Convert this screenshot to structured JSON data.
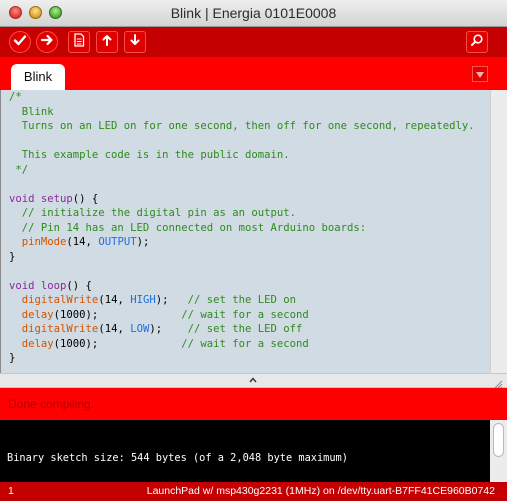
{
  "window": {
    "title": "Blink | Energia 0101E0008"
  },
  "toolbar": {
    "buttons": [
      {
        "name": "verify",
        "icon": "check-icon"
      },
      {
        "name": "upload",
        "icon": "arrow-right-icon"
      },
      {
        "name": "new",
        "icon": "document-icon"
      },
      {
        "name": "open",
        "icon": "arrow-up-icon"
      },
      {
        "name": "save",
        "icon": "arrow-down-icon"
      },
      {
        "name": "serial-monitor",
        "icon": "magnifier-icon"
      }
    ]
  },
  "tabs": [
    {
      "label": "Blink"
    }
  ],
  "editor": {
    "code": {
      "l1": "/*",
      "l2": "  Blink",
      "l3": "  Turns on an LED on for one second, then off for one second, repeatedly.",
      "l5": "  This example code is in the public domain.",
      "l6": " */",
      "l8a": "void",
      "l8b": " ",
      "l8c": "setup",
      "l8d": "() {",
      "l9": "  // initialize the digital pin as an output.",
      "l10": "  // Pin 14 has an LED connected on most Arduino boards:",
      "l11a": "  ",
      "l11b": "pinMode",
      "l11c": "(14, ",
      "l11d": "OUTPUT",
      "l11e": ");",
      "l12": "}",
      "l14a": "void",
      "l14c": "loop",
      "l14d": "() {",
      "l15b": "digitalWrite",
      "l15c": "(14, ",
      "l15d": "HIGH",
      "l15e": ");   ",
      "l15f": "// set the LED on",
      "l16b": "delay",
      "l16c": "(1000);             ",
      "l16f": "// wait for a second",
      "l17b": "digitalWrite",
      "l17c": "(14, ",
      "l17d": "LOW",
      "l17e": ");    ",
      "l17f": "// set the LED off",
      "l18b": "delay",
      "l18c": "(1000);             ",
      "l18f": "// wait for a second",
      "l19": "}"
    }
  },
  "status": {
    "message": "Done compiling."
  },
  "console": {
    "output": "Binary sketch size: 544 bytes (of a 2,048 byte maximum)"
  },
  "footer": {
    "line": "1",
    "board": "LaunchPad w/ msp430g2231 (1MHz) on /dev/tty.uart-B7FF41CE960B0742"
  },
  "colors": {
    "toolbar": "#c40000",
    "tabbar": "#ff0000",
    "editor_bg": "#d0dbe3",
    "console_bg": "#000000",
    "comment": "#2e8b1e",
    "keyword": "#8a2a9c",
    "function": "#d35400",
    "constant": "#1f6fe0"
  }
}
